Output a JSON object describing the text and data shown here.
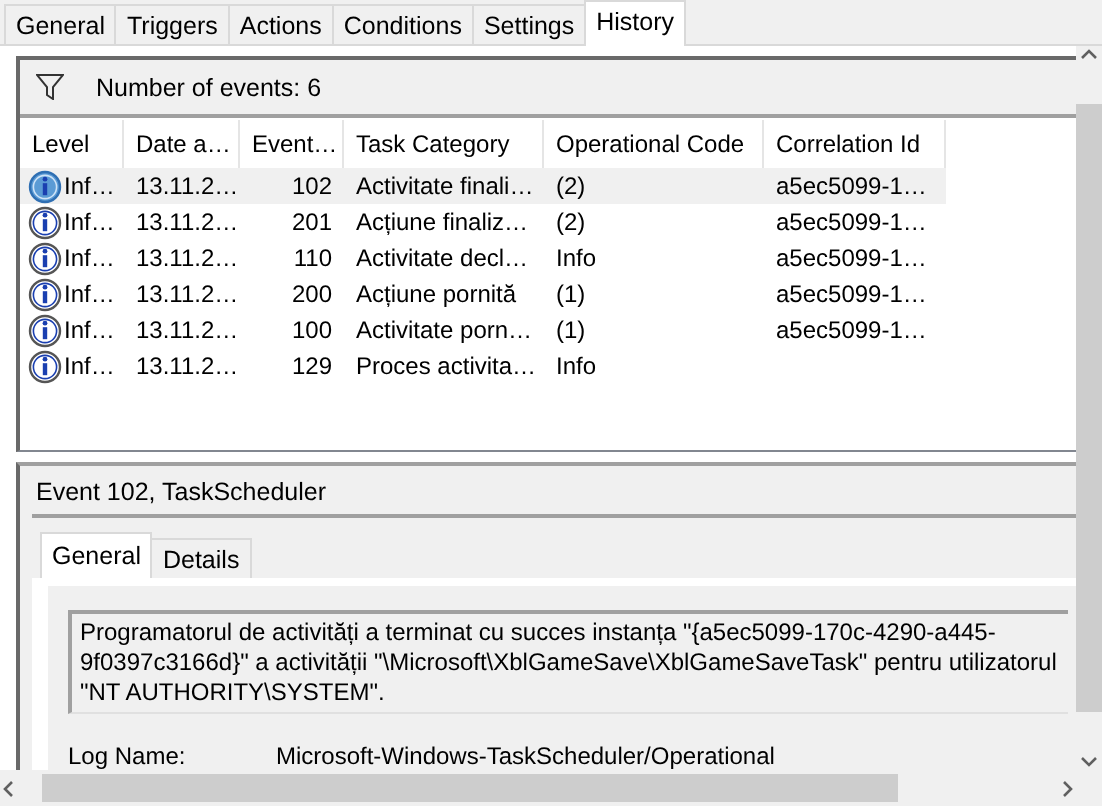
{
  "tabs": [
    {
      "label": "General",
      "selected": false
    },
    {
      "label": "Triggers",
      "selected": false
    },
    {
      "label": "Actions",
      "selected": false
    },
    {
      "label": "Conditions",
      "selected": false
    },
    {
      "label": "Settings",
      "selected": false
    },
    {
      "label": "History",
      "selected": true
    }
  ],
  "filter_bar": {
    "text": "Number of events: 6"
  },
  "table": {
    "columns": [
      "Level",
      "Date a…",
      "Event…",
      "Task Category",
      "Operational Code",
      "Correlation Id"
    ],
    "rows": [
      {
        "selected": true,
        "cells": [
          "Inf…",
          "13.11.2…",
          "102",
          "Activitate finali…",
          "(2)",
          "a5ec5099-1…"
        ]
      },
      {
        "selected": false,
        "cells": [
          "Inf…",
          "13.11.2…",
          "201",
          "Acțiune finaliz…",
          "(2)",
          "a5ec5099-1…"
        ]
      },
      {
        "selected": false,
        "cells": [
          "Inf…",
          "13.11.2…",
          "110",
          "Activitate decl…",
          "Info",
          "a5ec5099-1…"
        ]
      },
      {
        "selected": false,
        "cells": [
          "Inf…",
          "13.11.2…",
          "200",
          "Acțiune pornită",
          "(1)",
          "a5ec5099-1…"
        ]
      },
      {
        "selected": false,
        "cells": [
          "Inf…",
          "13.11.2…",
          "100",
          "Activitate porn…",
          "(1)",
          "a5ec5099-1…"
        ]
      },
      {
        "selected": false,
        "cells": [
          "Inf…",
          "13.11.2…",
          "129",
          "Proces activita…",
          "Info",
          ""
        ]
      }
    ]
  },
  "details": {
    "title": "Event 102, TaskScheduler",
    "tabs": [
      {
        "label": "General",
        "selected": true
      },
      {
        "label": "Details",
        "selected": false
      }
    ],
    "description": "Programatorul de activități a terminat cu succes instanța \"{a5ec5099-170c-4290-a445-9f0397c3166d}\" a activității \"\\Microsoft\\XblGameSave\\XblGameSaveTask\" pentru utilizatorul \"NT AUTHORITY\\SYSTEM\".",
    "fields": [
      {
        "label": "Log Name:",
        "value": "Microsoft-Windows-TaskScheduler/Operational"
      }
    ]
  }
}
